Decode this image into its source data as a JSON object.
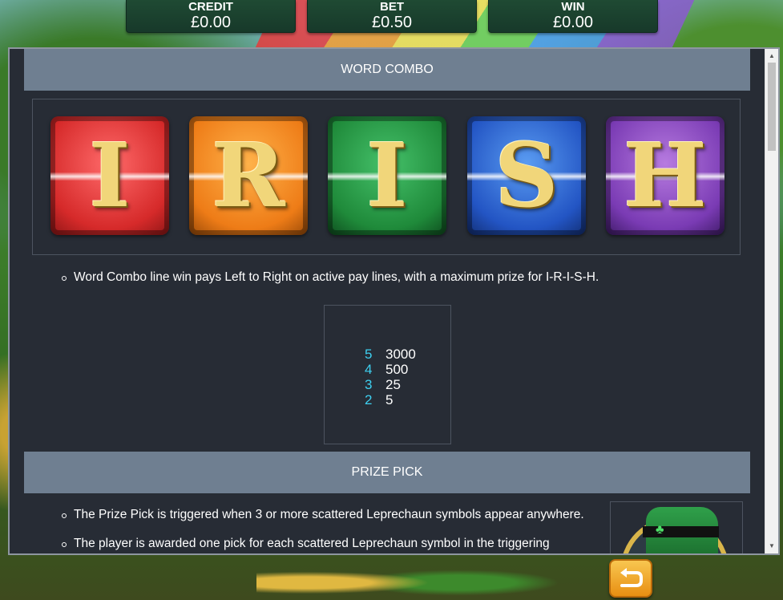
{
  "hud": {
    "credit": {
      "label": "CREDIT",
      "value": "£0.00"
    },
    "bet": {
      "label": "BET",
      "value": "£0.50"
    },
    "win": {
      "label": "WIN",
      "value": "£0.00"
    }
  },
  "word_combo": {
    "title": "WORD COMBO",
    "tiles": [
      {
        "letter": "I",
        "color": "#d62a2a"
      },
      {
        "letter": "R",
        "color": "#ee7c17"
      },
      {
        "letter": "I",
        "color": "#1f8a3a"
      },
      {
        "letter": "S",
        "color": "#2355c4"
      },
      {
        "letter": "H",
        "color": "#7a3bb4"
      }
    ],
    "description": "Word Combo line win pays Left to Right on active pay lines, with a maximum prize for I-R-I-S-H.",
    "paytable": [
      {
        "count": "5",
        "amount": "3000"
      },
      {
        "count": "4",
        "amount": "500"
      },
      {
        "count": "3",
        "amount": "25"
      },
      {
        "count": "2",
        "amount": "5"
      }
    ]
  },
  "prize_pick": {
    "title": "PRIZE PICK",
    "bullets": [
      "The Prize Pick is triggered when 3 or more scattered Leprechaun symbols appear anywhere.",
      "The player is awarded one pick for each scattered Leprechaun symbol in the triggering"
    ],
    "image_icon": "leprechaun-hat-icon"
  },
  "controls": {
    "back_icon": "return-arrow-icon"
  }
}
